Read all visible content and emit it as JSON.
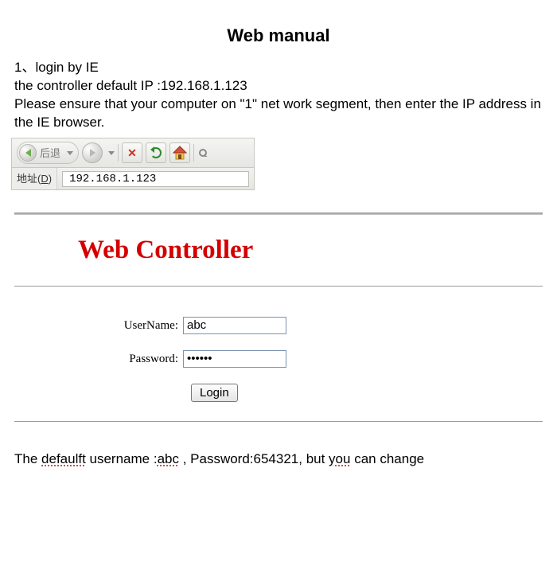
{
  "title": "Web manual",
  "intro": {
    "line1": "1、login by IE",
    "line2": "the controller default IP :192.168.1.123",
    "line3": "Please ensure that your computer on \"1\" net work segment, then enter the IP address in the IE browser."
  },
  "ie": {
    "back_label": "后退",
    "addr_label_prefix": "地址(",
    "addr_label_u": "D",
    "addr_label_suffix": ")",
    "address": "192.168.1.123"
  },
  "web_controller": {
    "title": "Web Controller",
    "username_label": "UserName:",
    "password_label": "Password:",
    "username_value": "abc",
    "password_value": "••••••",
    "login_label": "Login"
  },
  "footnote": {
    "prefix": "The ",
    "defaultt": "defaulft",
    "mid1": " username :",
    "abc": "abc",
    "mid2": " , Password:654321, but ",
    "you": "you",
    "tail": " can change"
  }
}
